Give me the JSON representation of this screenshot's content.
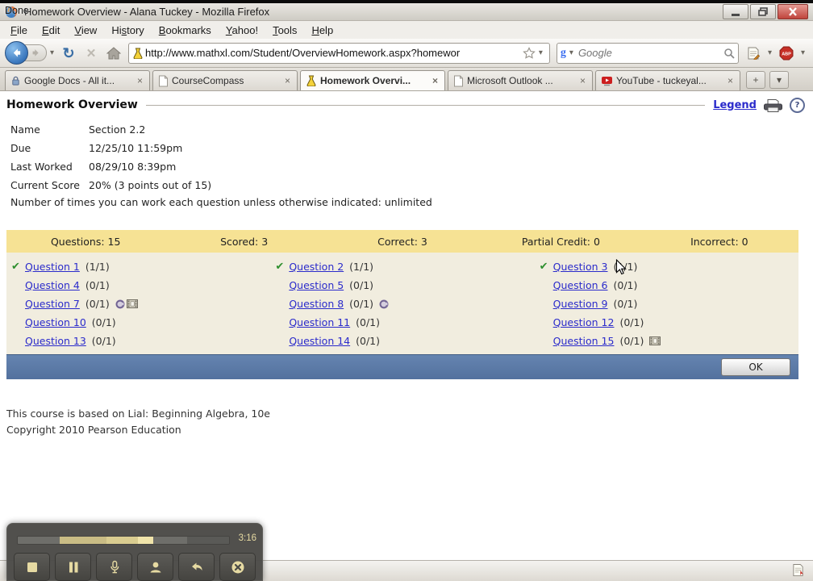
{
  "window": {
    "title": "Homework Overview - Alana Tuckey - Mozilla Firefox"
  },
  "menu": {
    "items": [
      {
        "label": "File",
        "accel": 0
      },
      {
        "label": "Edit",
        "accel": 0
      },
      {
        "label": "View",
        "accel": 0
      },
      {
        "label": "History",
        "accel": 2
      },
      {
        "label": "Bookmarks",
        "accel": 0
      },
      {
        "label": "Yahoo!",
        "accel": 0
      },
      {
        "label": "Tools",
        "accel": 0
      },
      {
        "label": "Help",
        "accel": 0
      }
    ]
  },
  "toolbar": {
    "url": "http://www.mathxl.com/Student/OverviewHomework.aspx?homewor",
    "search_placeholder": "Google"
  },
  "tabs": [
    {
      "label": "Google Docs - All it...",
      "icon": "google-docs",
      "active": false
    },
    {
      "label": "CourseCompass",
      "icon": "blank-page",
      "active": false
    },
    {
      "label": "Homework Overvi...",
      "icon": "mathxl",
      "active": true
    },
    {
      "label": "Microsoft Outlook ...",
      "icon": "blank-page",
      "active": false
    },
    {
      "label": "YouTube - tuckeyal...",
      "icon": "youtube",
      "active": false
    }
  ],
  "page": {
    "title": "Homework Overview",
    "legend_label": "Legend",
    "details": [
      {
        "label": "Name",
        "value": "Section 2.2"
      },
      {
        "label": "Due",
        "value": "12/25/10 11:59pm"
      },
      {
        "label": "Last Worked",
        "value": "08/29/10 8:39pm"
      },
      {
        "label": "Current Score",
        "value": "20% (3 points out of 15)"
      }
    ],
    "note": "Number of times you can work each question unless otherwise indicated: unlimited",
    "stats": [
      "Questions: 15",
      "Scored: 3",
      "Correct: 3",
      "Partial Credit: 0",
      "Incorrect: 0"
    ],
    "questions": [
      {
        "label": "Question 1",
        "score": "(1/1)",
        "correct": true,
        "icons": []
      },
      {
        "label": "Question 2",
        "score": "(1/1)",
        "correct": true,
        "icons": []
      },
      {
        "label": "Question 3",
        "score": "(1/1)",
        "correct": true,
        "icons": []
      },
      {
        "label": "Question 4",
        "score": "(0/1)",
        "correct": false,
        "icons": []
      },
      {
        "label": "Question 5",
        "score": "(0/1)",
        "correct": false,
        "icons": []
      },
      {
        "label": "Question 6",
        "score": "(0/1)",
        "correct": false,
        "icons": []
      },
      {
        "label": "Question 7",
        "score": "(0/1)",
        "correct": false,
        "icons": [
          "animation",
          "video"
        ]
      },
      {
        "label": "Question 8",
        "score": "(0/1)",
        "correct": false,
        "icons": [
          "animation"
        ]
      },
      {
        "label": "Question 9",
        "score": "(0/1)",
        "correct": false,
        "icons": []
      },
      {
        "label": "Question 10",
        "score": "(0/1)",
        "correct": false,
        "icons": []
      },
      {
        "label": "Question 11",
        "score": "(0/1)",
        "correct": false,
        "icons": []
      },
      {
        "label": "Question 12",
        "score": "(0/1)",
        "correct": false,
        "icons": []
      },
      {
        "label": "Question 13",
        "score": "(0/1)",
        "correct": false,
        "icons": []
      },
      {
        "label": "Question 14",
        "score": "(0/1)",
        "correct": false,
        "icons": []
      },
      {
        "label": "Question 15",
        "score": "(0/1)",
        "correct": false,
        "icons": [
          "video"
        ]
      }
    ],
    "ok_label": "OK",
    "footer": [
      "This course is based on Lial: Beginning Algebra, 10e",
      "Copyright 2010 Pearson Education"
    ]
  },
  "player": {
    "time": "3:16",
    "buttons": [
      "stop",
      "pause",
      "mic",
      "webcam",
      "undo",
      "cancel"
    ],
    "progress_segments": [
      {
        "from": 0,
        "to": 20,
        "color": "#6e6e6a"
      },
      {
        "from": 20,
        "to": 42,
        "color": "#c9bc85"
      },
      {
        "from": 42,
        "to": 57,
        "color": "#d9cc90"
      },
      {
        "from": 57,
        "to": 64,
        "color": "#f0e4aa"
      },
      {
        "from": 64,
        "to": 80,
        "color": "#6e6e6a"
      },
      {
        "from": 80,
        "to": 100,
        "color": "#5a5a57"
      }
    ]
  },
  "statusbar": {
    "text": "Done"
  },
  "colors": {
    "link": "#2b2bcb",
    "check_green": "#2e8f2e",
    "stats_yellow": "#f6e294",
    "questions_cream": "#f1eddf",
    "action_bar_blue": "#53719e",
    "action_bar_blue_light": "#6584b0",
    "player_tan": "#e6daa2"
  }
}
